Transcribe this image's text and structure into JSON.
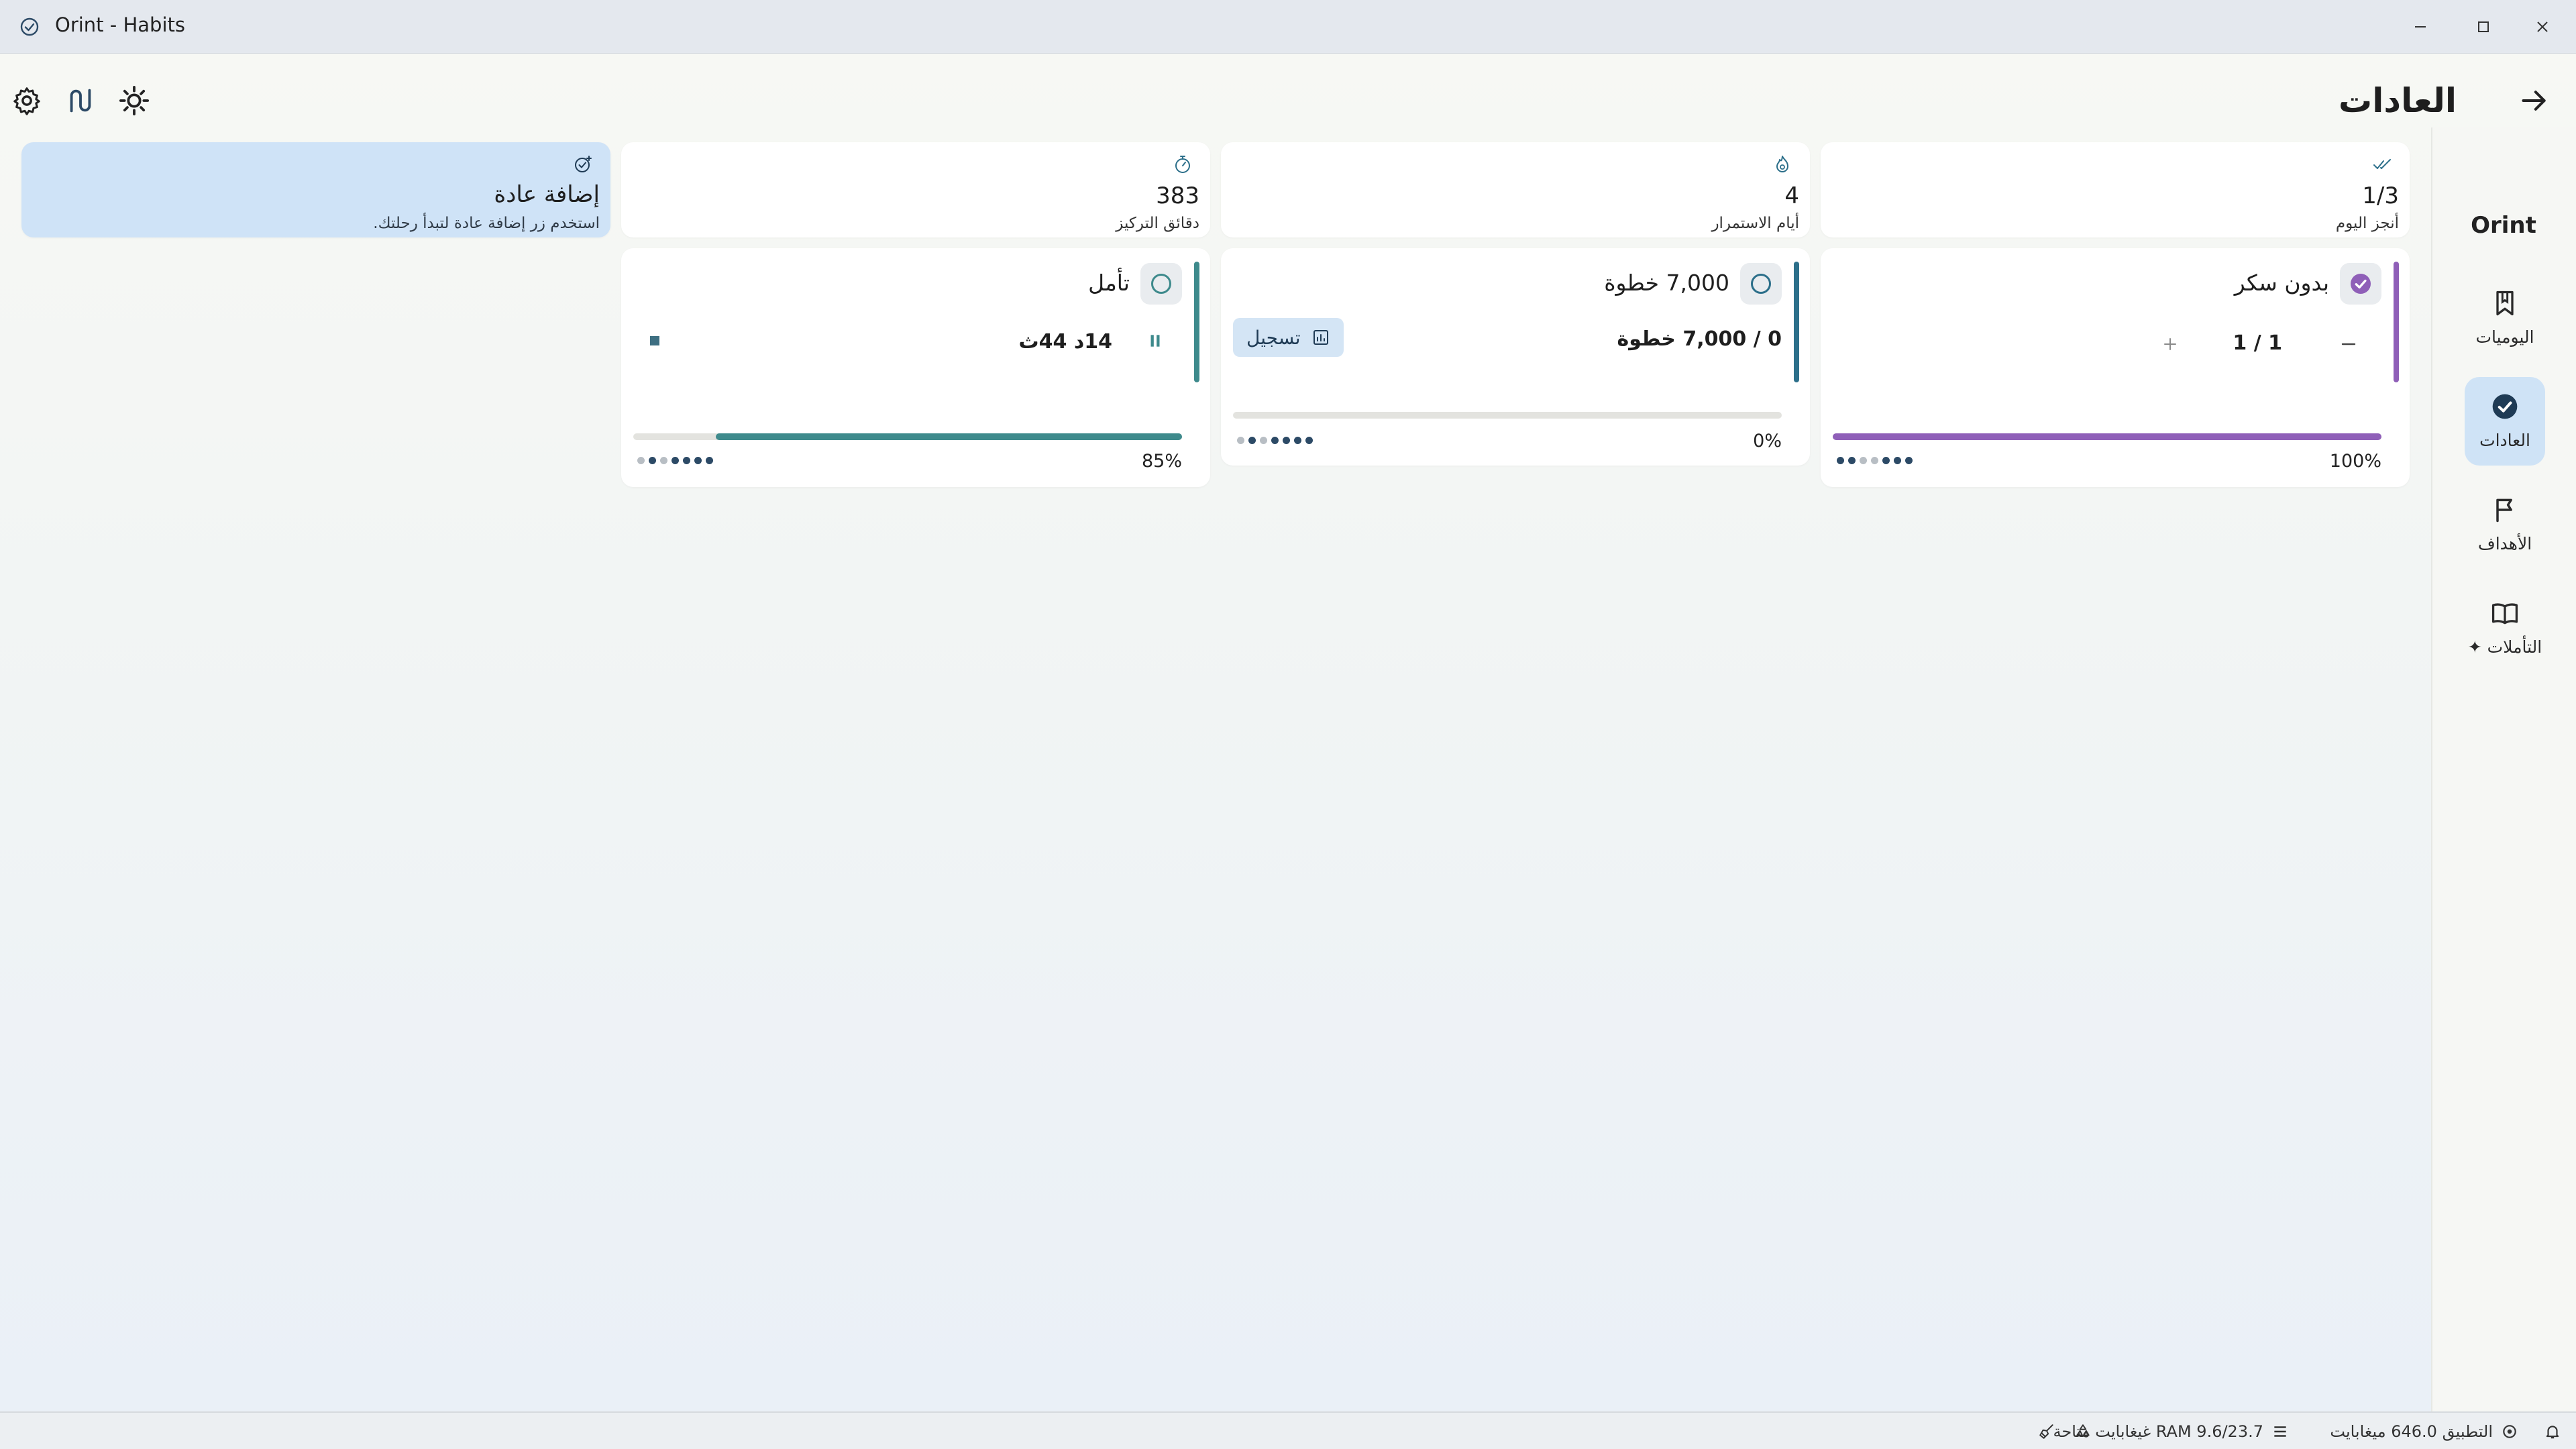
{
  "window": {
    "title": "Orint - Habits"
  },
  "header": {
    "title": "العادات"
  },
  "nav": {
    "brand": "Orint",
    "items": [
      {
        "label": "اليوميات",
        "icon": "bookmark-icon",
        "active": false
      },
      {
        "label": "العادات",
        "icon": "check-circle-icon",
        "active": true
      },
      {
        "label": "الأهداف",
        "icon": "flag-icon",
        "active": false
      },
      {
        "label": "التأملات ✦",
        "icon": "book-open-icon",
        "active": false
      }
    ]
  },
  "stats": [
    {
      "value": "1/3",
      "label": "أنجز اليوم",
      "icon": "double-check-icon"
    },
    {
      "value": "4",
      "label": "أيام الاستمرار",
      "icon": "flame-icon"
    },
    {
      "value": "383",
      "label": "دقائق التركيز",
      "icon": "stopwatch-icon"
    }
  ],
  "add_habit": {
    "title": "إضافة عادة",
    "subtitle": "استخدم زر إضافة عادة لتبدأ رحلتك."
  },
  "habits": [
    {
      "name": "بدون سكر",
      "type": "counter",
      "color": "#8f5fb8",
      "done": true,
      "counter": "1 / 1",
      "percent_label": "100%",
      "progress": 1.0,
      "week": [
        1,
        1,
        0,
        0,
        1,
        1,
        1
      ]
    },
    {
      "name": "7,000 خطوة",
      "type": "quantity",
      "color": "#2c6f8a",
      "done": false,
      "counter": "0 / 7,000 خطوة",
      "log_label": "تسجيل",
      "percent_label": "0%",
      "progress": 0.0,
      "week": [
        0,
        1,
        0,
        1,
        1,
        1,
        1
      ]
    },
    {
      "name": "تأمل",
      "type": "timer",
      "color": "#3e8a8c",
      "done": false,
      "timer": "14د 44ث",
      "percent_label": "85%",
      "progress": 0.85,
      "week": [
        0,
        1,
        0,
        1,
        1,
        1,
        1
      ]
    }
  ],
  "statusbar": {
    "app_memory": "التطبيق 646.0 ميغابايت",
    "ram": "RAM 9.6/23.7 غيغابايت متاحة"
  },
  "colors": {
    "accent": "#2c6f8a",
    "nav_active_bg": "#cfe3f6",
    "add_card_bg": "#cfe3f7",
    "dot_on": "#2c4a66",
    "dot_off": "#b8bec4"
  }
}
